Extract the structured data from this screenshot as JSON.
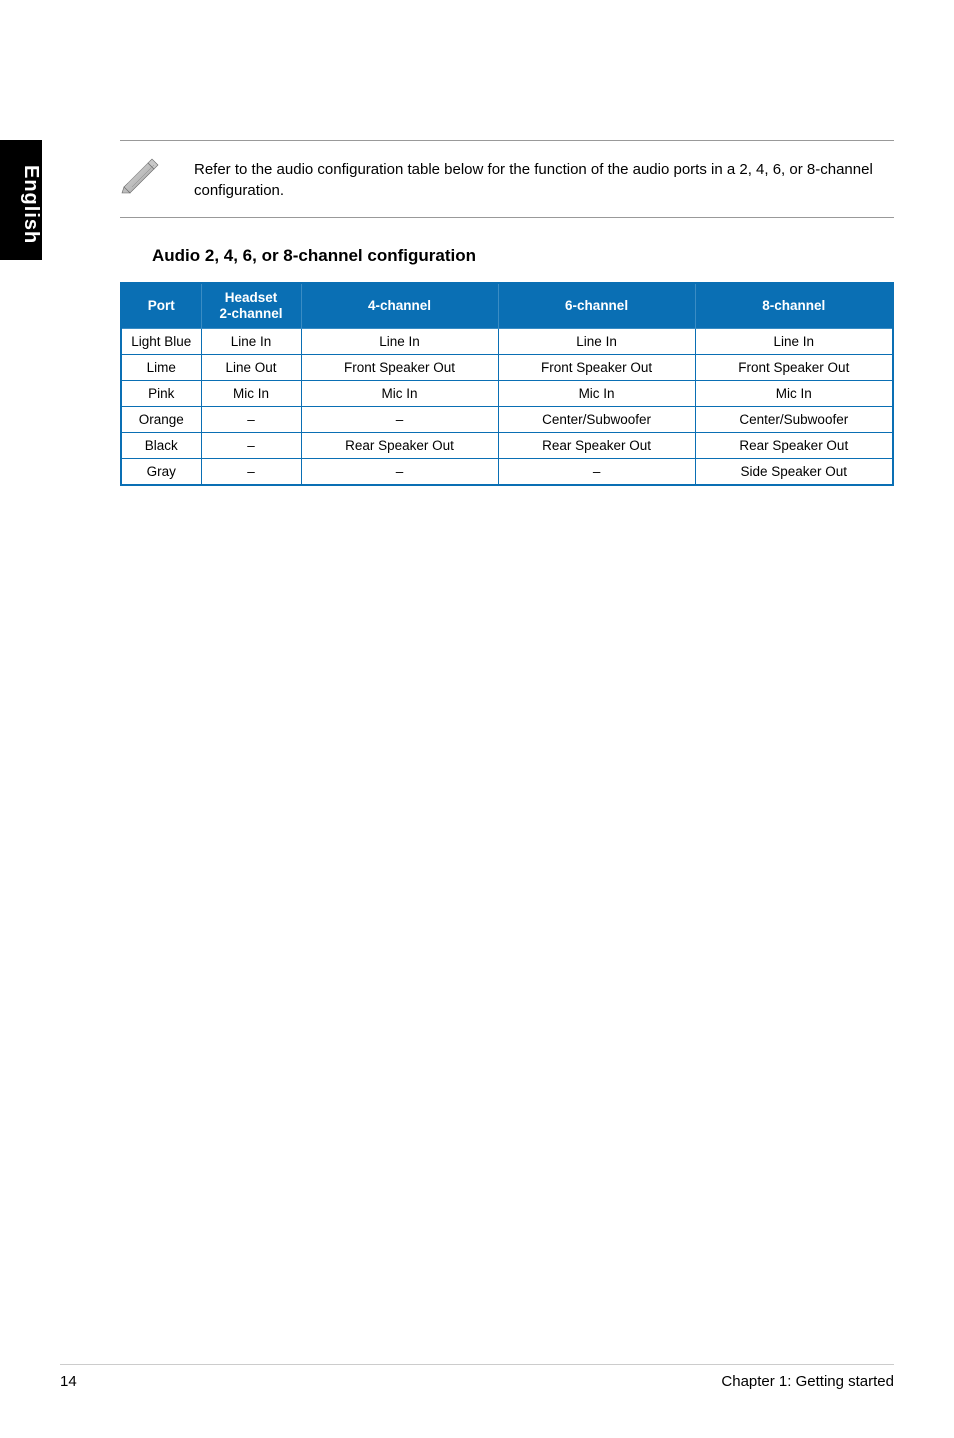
{
  "side_tab": "English",
  "note": {
    "text": "Refer to the audio configuration table below for the function of the audio ports in a 2, 4, 6, or 8-channel configuration."
  },
  "section": {
    "heading": "Audio 2, 4, 6, or 8-channel configuration"
  },
  "table": {
    "headers": {
      "port": "Port",
      "headset": "Headset\n2-channel",
      "ch4": "4-channel",
      "ch6": "6-channel",
      "ch8": "8-channel"
    },
    "rows": [
      {
        "port": "Light Blue",
        "hs": "Line In",
        "c4": "Line In",
        "c6": "Line In",
        "c8": "Line In"
      },
      {
        "port": "Lime",
        "hs": "Line Out",
        "c4": "Front Speaker Out",
        "c6": "Front Speaker Out",
        "c8": "Front Speaker Out"
      },
      {
        "port": "Pink",
        "hs": "Mic In",
        "c4": "Mic In",
        "c6": "Mic In",
        "c8": "Mic In"
      },
      {
        "port": "Orange",
        "hs": "–",
        "c4": "–",
        "c6": "Center/Subwoofer",
        "c8": "Center/Subwoofer"
      },
      {
        "port": "Black",
        "hs": "–",
        "c4": "Rear Speaker Out",
        "c6": "Rear Speaker Out",
        "c8": "Rear Speaker Out"
      },
      {
        "port": "Gray",
        "hs": "–",
        "c4": "–",
        "c6": "–",
        "c8": "Side Speaker Out"
      }
    ]
  },
  "footer": {
    "page": "14",
    "chapter": "Chapter 1: Getting started"
  }
}
